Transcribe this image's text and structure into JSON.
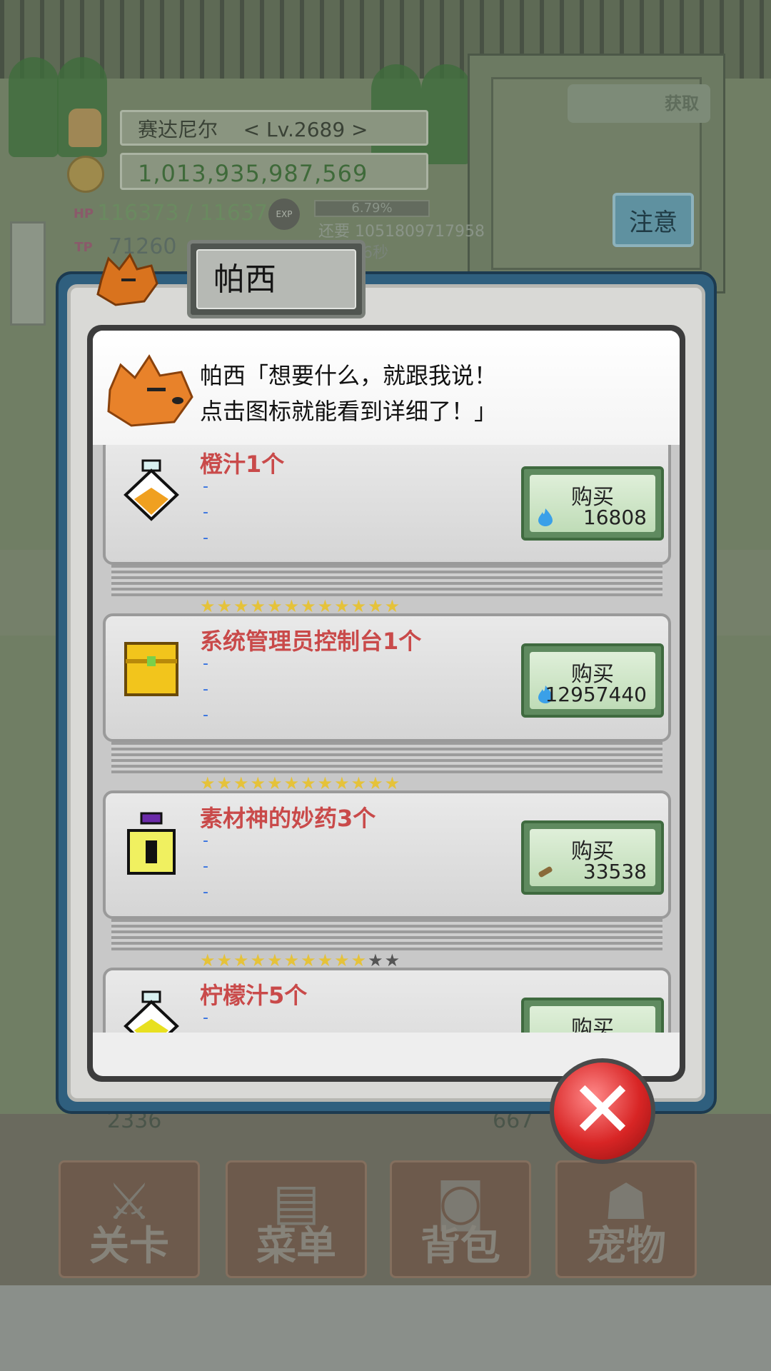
{
  "hud": {
    "player_name": "赛达尼尔",
    "player_level": "< Lv.2689 >",
    "gold": "1,013,935,987,569",
    "hp_label": "HP",
    "hp_value": "116373 / 116373",
    "tp_label": "TP",
    "tp_value": "71260",
    "exp_badge": "EXP",
    "exp_percent": "6.79%",
    "exp_remaining": "还要 1051809717958",
    "tp_timer": "6秒",
    "get_orb_label": "获取",
    "notice_button": "注意"
  },
  "dialog": {
    "title": "帕西",
    "speech_line1": "帕西「想要什么，就跟我说！",
    "speech_line2": "点击图标就能看到详细了！」",
    "buy_label": "购买",
    "items": [
      {
        "name": "橙汁1个",
        "stars": "",
        "price": "16808",
        "currency": "flame",
        "icon": "orange-juice-icon"
      },
      {
        "name": "系统管理员控制台1个",
        "stars": "★★★★★★★★★★★★",
        "stars_off": "",
        "price": "12957440",
        "currency": "flame",
        "icon": "treasure-chest-icon"
      },
      {
        "name": "素材神的妙药3个",
        "stars": "★★★★★★★★★★★★",
        "stars_off": "",
        "price": "33538",
        "currency": "wood",
        "icon": "potion-bottle-icon"
      },
      {
        "name": "柠檬汁5个",
        "stars": "★★★★★★★★★★",
        "stars_off": "★★",
        "price": "",
        "currency": "flame",
        "icon": "lemon-juice-icon"
      }
    ],
    "dash": "-"
  },
  "nav": {
    "stage": "关卡",
    "menu": "菜单",
    "bag": "背包",
    "pet": "宠物"
  },
  "ground": {
    "left_stat": "2336",
    "right_stat": "667"
  },
  "colors": {
    "item_name": "#c94a4a",
    "dash": "#2e6de0",
    "dialog_frame": "#2f5f7e",
    "close_button": "#d82525"
  }
}
